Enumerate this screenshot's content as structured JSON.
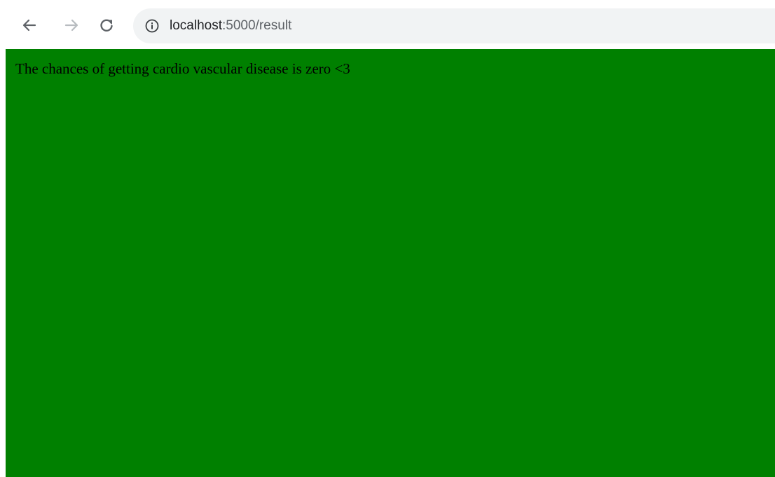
{
  "browser": {
    "url_host": "localhost",
    "url_path": ":5000/result",
    "back_icon": "arrow-left-icon",
    "forward_icon": "arrow-right-icon",
    "reload_icon": "reload-icon",
    "info_icon": "info-icon"
  },
  "page": {
    "background_color": "#008000",
    "message": "The chances of getting cardio vascular disease is zero <3"
  }
}
